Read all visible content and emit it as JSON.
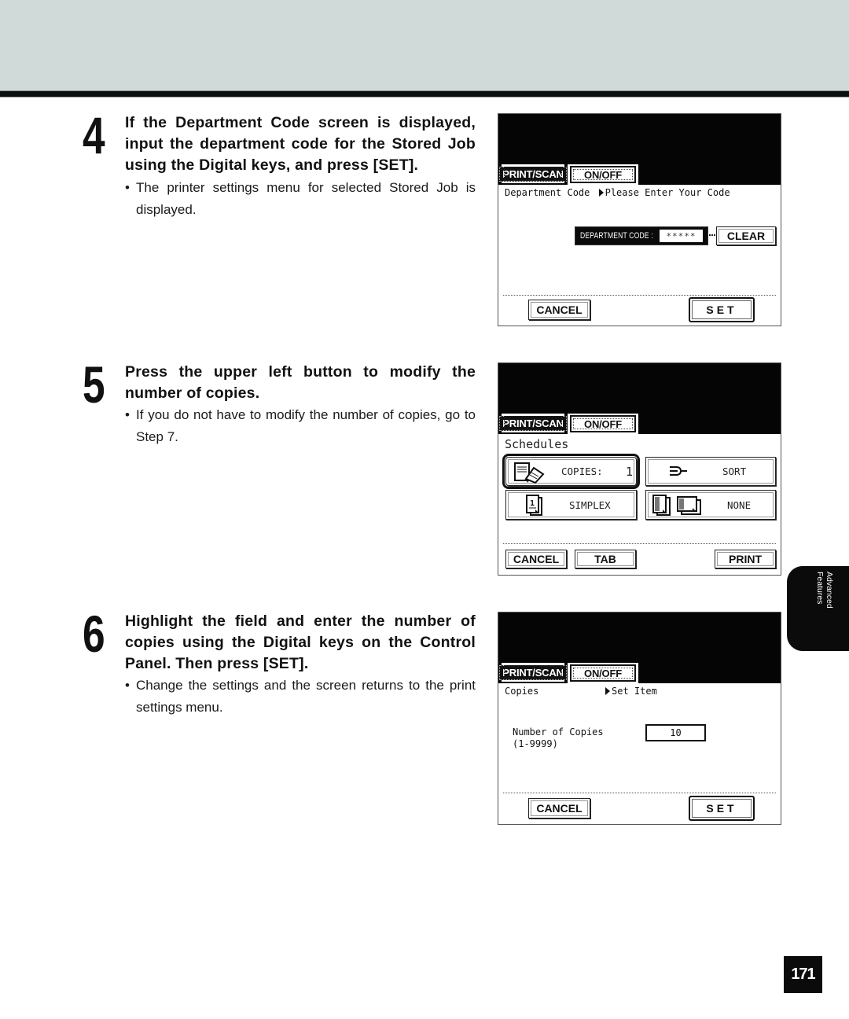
{
  "steps": [
    {
      "number": "4",
      "title": "If the Department Code screen is displayed, input the department code for the Stored Job using the Digital keys, and press [SET].",
      "note": "The printer settings menu for selected Stored Job is displayed."
    },
    {
      "number": "5",
      "title": "Press the upper left button to modify the number of copies.",
      "note": "If you do not have to modify the number of copies, go to Step 7."
    },
    {
      "number": "6",
      "title": "Highlight the field and enter the number of copies using the Digital keys on the Control Panel. Then press [SET].",
      "note": "Change the settings and the screen returns to the print settings menu."
    }
  ],
  "bullet": "•",
  "screens": {
    "department_code": {
      "tab_print_scan": "PRINT/SCAN",
      "tab_on_off": "ON/OFF",
      "heading": "Department Code",
      "prompt": "Please Enter Your Code",
      "field_label": "DEPARTMENT CODE :",
      "field_value": "*****",
      "clear_label": "CLEAR",
      "cancel_label": "CANCEL",
      "set_label": "SET"
    },
    "schedules": {
      "tab_print_scan": "PRINT/SCAN",
      "tab_on_off": "ON/OFF",
      "heading": "Schedules",
      "copies_label": "COPIES:",
      "copies_value": "1",
      "sort_label": "SORT",
      "simplex_label": "SIMPLEX",
      "staple_label": "NONE",
      "cancel_label": "CANCEL",
      "tab_label": "TAB",
      "print_label": "PRINT"
    },
    "copies": {
      "tab_print_scan": "PRINT/SCAN",
      "tab_on_off": "ON/OFF",
      "heading": "Copies",
      "prompt": "Set Item",
      "field_label": "Number of Copies",
      "field_range": "(1-9999)",
      "field_value": "10",
      "cancel_label": "CANCEL",
      "set_label": "SET"
    }
  },
  "side_tab": {
    "line1": "Advanced",
    "line2": "Features"
  },
  "page_number": "171"
}
